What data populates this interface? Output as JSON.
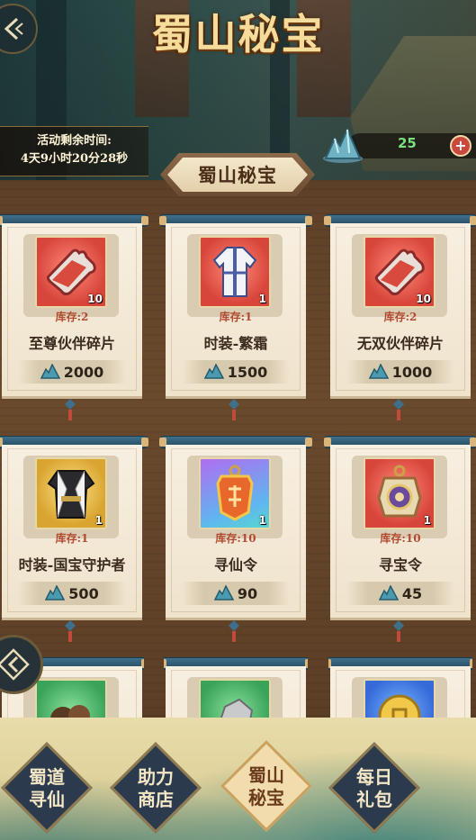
{
  "header": {
    "title": "蜀山秘宝",
    "timer_label": "活动剩余时间:",
    "timer_value": "4天9小时20分28秒",
    "currency_count": "25",
    "currency_add": "+"
  },
  "section_tab": "蜀山秘宝",
  "items": [
    {
      "stock": "库存:2",
      "name": "至尊伙伴碎片",
      "qty": "10",
      "price": "2000",
      "icon": "puzzle-piece-icon",
      "bg": "red"
    },
    {
      "stock": "库存:1",
      "name": "时装-繁霜",
      "qty": "1",
      "price": "1500",
      "icon": "robe-icon",
      "bg": "red"
    },
    {
      "stock": "库存:2",
      "name": "无双伙伴碎片",
      "qty": "10",
      "price": "1000",
      "icon": "puzzle-piece-icon",
      "bg": "red"
    },
    {
      "stock": "库存:1",
      "name": "时装-国宝守护者",
      "qty": "1",
      "price": "500",
      "icon": "armor-icon",
      "bg": "yellow"
    },
    {
      "stock": "库存:10",
      "name": "寻仙令",
      "qty": "1",
      "price": "90",
      "icon": "token-icon",
      "bg": "purple"
    },
    {
      "stock": "库存:10",
      "name": "寻宝令",
      "qty": "1",
      "price": "45",
      "icon": "medallion-icon",
      "bg": "red"
    }
  ],
  "partial_items": [
    {
      "icon": "stones-icon",
      "bg": "green"
    },
    {
      "icon": "ore-icon",
      "bg": "green"
    },
    {
      "icon": "coin-icon",
      "bg": "blue"
    }
  ],
  "nav": [
    {
      "line1": "蜀道",
      "line2": "寻仙",
      "active": false
    },
    {
      "line1": "助力",
      "line2": "商店",
      "active": false
    },
    {
      "line1": "蜀山",
      "line2": "秘宝",
      "active": true
    },
    {
      "line1": "每日",
      "line2": "礼包",
      "active": false
    }
  ],
  "colors": {
    "title_gold": "#f6dc9a",
    "currency_green": "#7be07d",
    "stock_red": "#b14a30",
    "nav_dark": "#2c3a4e",
    "nav_active": "#f2dcae"
  }
}
